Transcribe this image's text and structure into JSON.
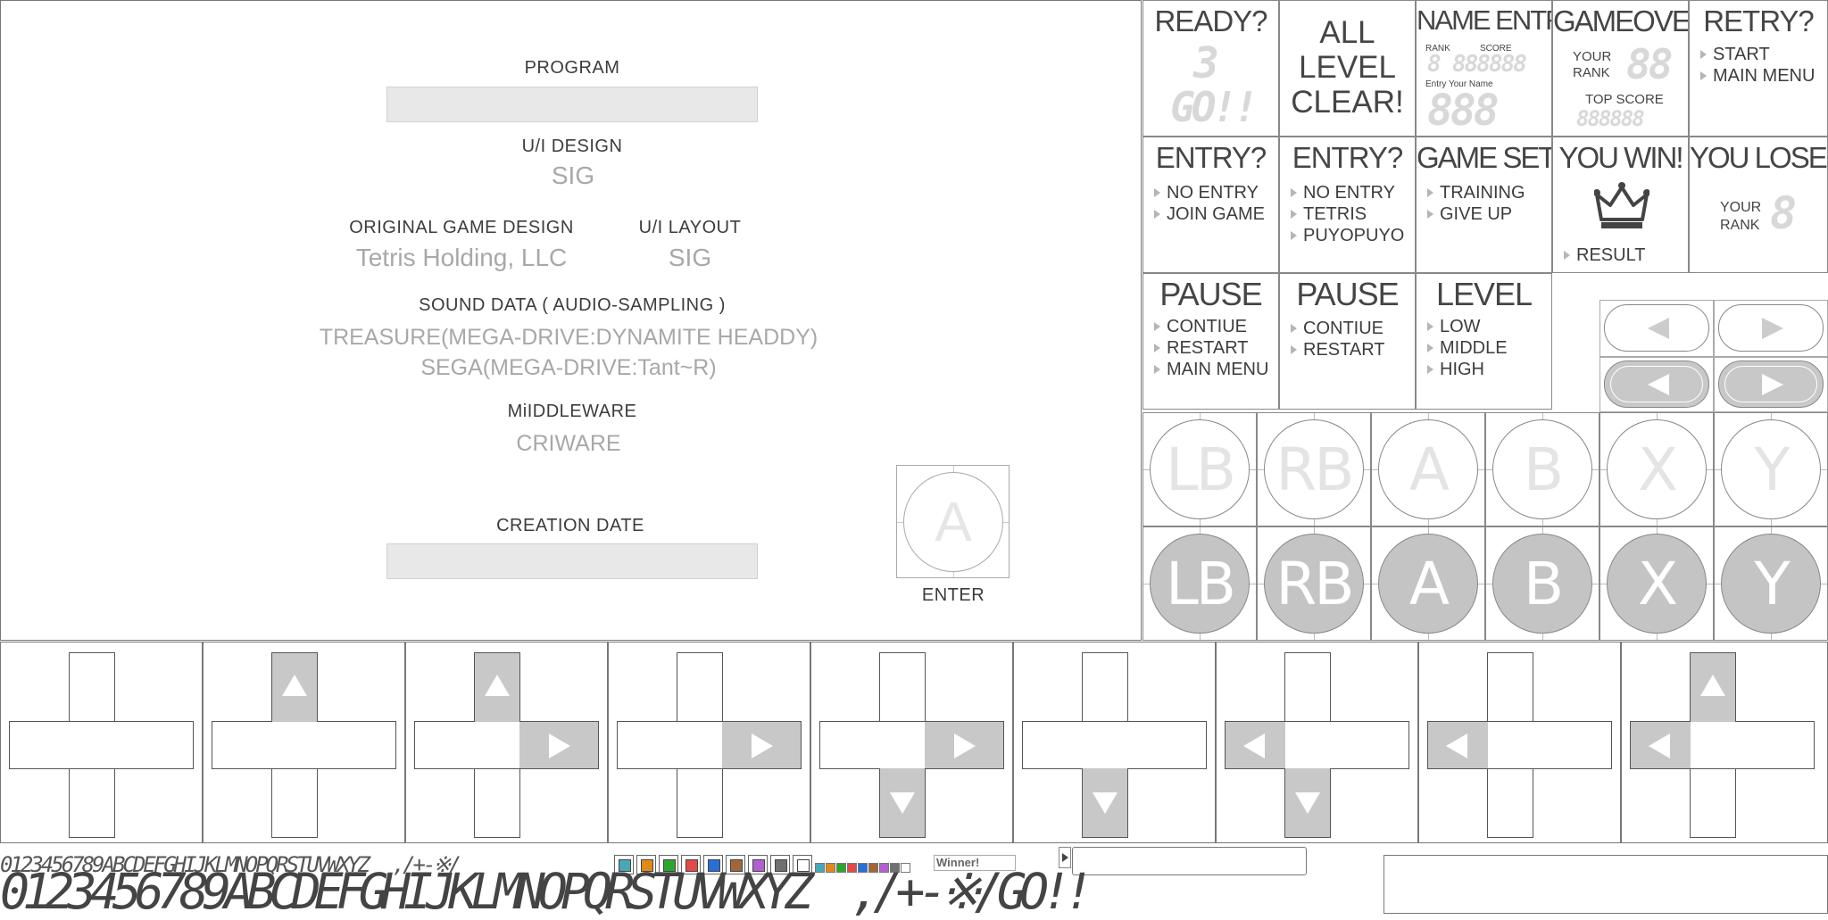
{
  "credits": {
    "program_label": "PROGRAM",
    "ui_design_label": "U/I DESIGN",
    "ui_design_value": "SIG",
    "orig_design_label": "ORIGINAL GAME DESIGN",
    "orig_design_value": "Tetris Holding, LLC",
    "ui_layout_label": "U/I LAYOUT",
    "ui_layout_value": "SIG",
    "sound_label": "SOUND DATA ( AUDIO-SAMPLING )",
    "sound_value_1": "TREASURE(MEGA-DRIVE:DYNAMITE HEADDY)",
    "sound_value_2": "SEGA(MEGA-DRIVE:Tant~R)",
    "middleware_label": "MiIDDLEWARE",
    "middleware_value": "CRIWARE",
    "creation_label": "CREATION DATE",
    "enter_button": "A",
    "enter_label": "ENTER"
  },
  "tiles": {
    "ready": {
      "title": "READY?",
      "count": "3",
      "go": "GO!!"
    },
    "all_clear": {
      "title": "ALL LEVEL CLEAR!"
    },
    "name_entry": {
      "title": "NAME ENTRY",
      "rank_label": "RANK",
      "score_label": "SCORE",
      "rank_digits": "8",
      "score_digits": "888888",
      "entry_label": "Entry Your Name",
      "name_digits": "888"
    },
    "gameover": {
      "title": "GAMEOVER",
      "your_rank": "YOUR",
      "rank": "RANK",
      "rank_digits": "88",
      "top_score": "TOP SCORE",
      "score_digits": "888888"
    },
    "retry": {
      "title": "RETRY?",
      "options": [
        "START",
        "MAIN MENU"
      ]
    },
    "entry1": {
      "title": "ENTRY?",
      "options": [
        "NO ENTRY",
        "JOIN GAME"
      ]
    },
    "entry2": {
      "title": "ENTRY?",
      "options": [
        "NO ENTRY",
        "TETRIS",
        "PUYOPUYO"
      ]
    },
    "game_set": {
      "title": "GAME SET",
      "options": [
        "TRAINING",
        "GIVE UP"
      ]
    },
    "you_win": {
      "title": "YOU WIN!",
      "option": "RESULT"
    },
    "you_lose": {
      "title": "YOU LOSE!",
      "your_rank": "YOUR",
      "rank": "RANK",
      "rank_digits": "8"
    },
    "pause1": {
      "title": "PAUSE",
      "options": [
        "CONTIUE",
        "RESTART",
        "MAIN MENU"
      ]
    },
    "pause2": {
      "title": "PAUSE",
      "options": [
        "CONTIUE",
        "RESTART"
      ]
    },
    "level": {
      "title": "LEVEL",
      "options": [
        "LOW",
        "MIDDLE",
        "HIGH"
      ]
    }
  },
  "buttons_outline": [
    "LB",
    "RB",
    "A",
    "B",
    "X",
    "Y"
  ],
  "buttons_filled": [
    "LB",
    "RB",
    "A",
    "B",
    "X",
    "Y"
  ],
  "font_strip": {
    "small": "0123456789ABCDEFGHIJKLMNOPQRSTUVWXYZ",
    "small_sym": ",/+-※/",
    "winner": "Winner!",
    "large": "0123456789ABCDEFGHIJKLMNOPQRSTUVWXYZ",
    "large_sym": ",/+-※/GO!!",
    "swatch_colors": [
      "#4aa7b5",
      "#e08a1e",
      "#2ea52e",
      "#e04a4a",
      "#2a6fd6",
      "#a0683a",
      "#b060d0",
      "#707070",
      "#ffffff"
    ]
  },
  "dpads": [
    {
      "up": false,
      "right": false,
      "down": false,
      "left": false
    },
    {
      "up": true,
      "right": false,
      "down": false,
      "left": false
    },
    {
      "up": true,
      "right": true,
      "down": false,
      "left": false
    },
    {
      "up": false,
      "right": true,
      "down": false,
      "left": false
    },
    {
      "up": false,
      "right": true,
      "down": true,
      "left": false
    },
    {
      "up": false,
      "right": false,
      "down": true,
      "left": false
    },
    {
      "up": false,
      "right": false,
      "down": true,
      "left": true
    },
    {
      "up": false,
      "right": false,
      "down": false,
      "left": true
    },
    {
      "up": true,
      "right": false,
      "down": false,
      "left": true
    }
  ]
}
